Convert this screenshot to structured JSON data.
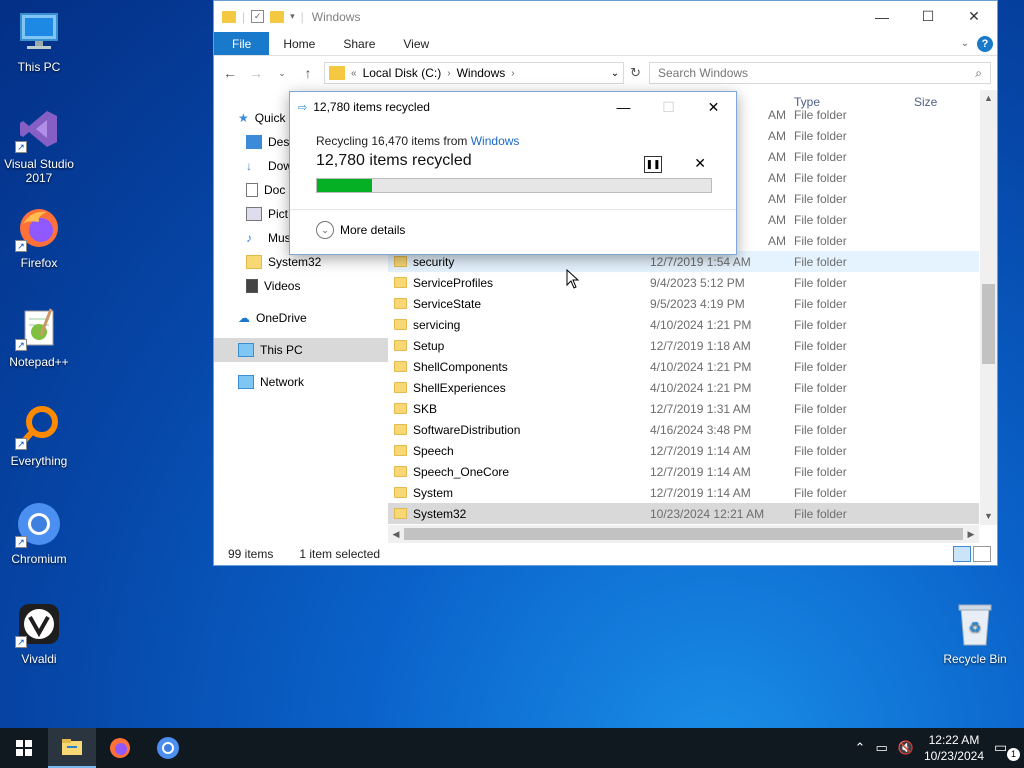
{
  "desktop": {
    "icons": [
      {
        "label": "This PC"
      },
      {
        "label": "Visual Studio 2017"
      },
      {
        "label": "Firefox"
      },
      {
        "label": "Notepad++"
      },
      {
        "label": "Everything"
      },
      {
        "label": "Chromium"
      },
      {
        "label": "Vivaldi"
      },
      {
        "label": "Recycle Bin"
      }
    ]
  },
  "explorer": {
    "title": "Windows",
    "ribbon_tabs": [
      "File",
      "Home",
      "Share",
      "View"
    ],
    "address": {
      "prefix": "«",
      "parts": [
        "Local Disk (C:)",
        "Windows"
      ]
    },
    "search_placeholder": "Search Windows",
    "nav": {
      "quick": "Quick",
      "items": [
        "Desk",
        "Dow",
        "Doc",
        "Pict",
        "Mus",
        "System32",
        "Videos"
      ],
      "onedrive": "OneDrive",
      "thispc": "This PC",
      "network": "Network"
    },
    "columns": {
      "type": "Type",
      "size": "Size"
    },
    "partial_rows": [
      "AM",
      "AM",
      "AM",
      "AM",
      "AM",
      "AM",
      "AM"
    ],
    "partial_types": [
      "File folder",
      "File folder",
      "File folder",
      "File folder",
      "File folder",
      "File folder",
      "File folder"
    ],
    "rows": [
      {
        "name": "security",
        "date": "12/7/2019 1:54 AM",
        "type": "File folder"
      },
      {
        "name": "ServiceProfiles",
        "date": "9/4/2023 5:12 PM",
        "type": "File folder"
      },
      {
        "name": "ServiceState",
        "date": "9/5/2023 4:19 PM",
        "type": "File folder"
      },
      {
        "name": "servicing",
        "date": "4/10/2024 1:21 PM",
        "type": "File folder"
      },
      {
        "name": "Setup",
        "date": "12/7/2019 1:18 AM",
        "type": "File folder"
      },
      {
        "name": "ShellComponents",
        "date": "4/10/2024 1:21 PM",
        "type": "File folder"
      },
      {
        "name": "ShellExperiences",
        "date": "4/10/2024 1:21 PM",
        "type": "File folder"
      },
      {
        "name": "SKB",
        "date": "12/7/2019 1:31 AM",
        "type": "File folder"
      },
      {
        "name": "SoftwareDistribution",
        "date": "4/16/2024 3:48 PM",
        "type": "File folder"
      },
      {
        "name": "Speech",
        "date": "12/7/2019 1:14 AM",
        "type": "File folder"
      },
      {
        "name": "Speech_OneCore",
        "date": "12/7/2019 1:14 AM",
        "type": "File folder"
      },
      {
        "name": "System",
        "date": "12/7/2019 1:14 AM",
        "type": "File folder"
      },
      {
        "name": "System32",
        "date": "10/23/2024 12:21 AM",
        "type": "File folder"
      }
    ],
    "status": {
      "count": "99 items",
      "selected": "1 item selected"
    }
  },
  "dialog": {
    "title": "12,780 items recycled",
    "line1_prefix": "Recycling 16,470 items from ",
    "line1_link": "Windows",
    "big": "12,780 items recycled",
    "progress_fraction": 0.14,
    "more_details": "More details"
  },
  "taskbar": {
    "time": "12:22 AM",
    "date": "10/23/2024",
    "notif_count": "1"
  },
  "colors": {
    "accent": "#1979ca",
    "progress": "#06b025"
  }
}
